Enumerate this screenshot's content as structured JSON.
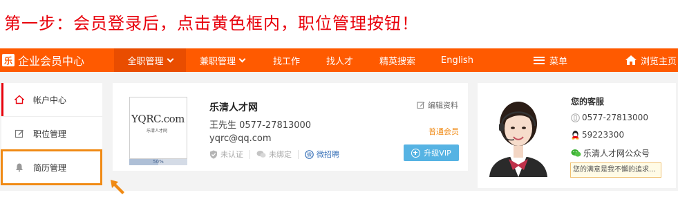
{
  "instruction": "第一步：会员登录后，点击黄色框内，职位管理按钮！",
  "brand": {
    "logo_char": "乐",
    "name": "企业会员中心"
  },
  "nav": {
    "items": [
      {
        "label": "全职管理",
        "has_caret": true,
        "active": true
      },
      {
        "label": "兼职管理",
        "has_caret": true,
        "active": false
      },
      {
        "label": "找工作",
        "has_caret": false,
        "active": false
      },
      {
        "label": "找人才",
        "has_caret": false,
        "active": false
      },
      {
        "label": "精英搜索",
        "has_caret": false,
        "active": false
      },
      {
        "label": "English",
        "has_caret": false,
        "active": false
      }
    ],
    "menu_label": "菜单",
    "home_label": "浏览主页"
  },
  "sidebar": {
    "items": [
      {
        "label": "帐户中心",
        "icon": "home-icon",
        "active": true
      },
      {
        "label": "职位管理",
        "icon": "edit-icon",
        "active": false
      },
      {
        "label": "简历管理",
        "icon": "bell-icon",
        "active": false
      }
    ]
  },
  "profile": {
    "logo_text": "YQRC.com",
    "logo_subtext": "乐清人才网",
    "progress_percent": 50,
    "progress_label": "50%",
    "company_name": "乐清人才网",
    "contact": "王先生 0577-27813000",
    "email": "yqrc@qq.com",
    "verify_labels": [
      "未认证",
      "未绑定",
      "微招聘"
    ],
    "edit_label": "编辑资料",
    "member_level": "普通会员",
    "upgrade_label": "升级VIP"
  },
  "service": {
    "title": "您的客服",
    "phone": "0577-27813000",
    "qq": "59223300",
    "wechat": "乐清人才网公众号",
    "motto": "您的满意是我不懈的追求..."
  },
  "colors": {
    "brand_orange": "#ff5a00",
    "active_nav": "#e94d00",
    "instruction_red": "#e8000b",
    "highlight_orange": "#f08a14",
    "upgrade_blue": "#56b3e3"
  }
}
